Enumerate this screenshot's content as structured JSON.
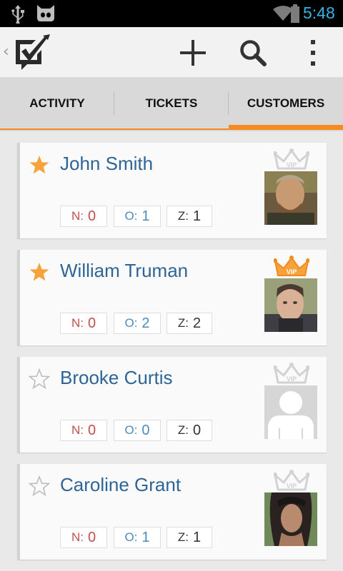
{
  "status_bar": {
    "time": "5:48"
  },
  "action_bar": {
    "up": "‹"
  },
  "tabs": [
    {
      "label": "ACTIVITY",
      "selected": false
    },
    {
      "label": "TICKETS",
      "selected": false
    },
    {
      "label": "CUSTOMERS",
      "selected": true
    }
  ],
  "customers": [
    {
      "name": "John Smith",
      "starred": true,
      "vip": false,
      "n_label": "N:",
      "n": "0",
      "o_label": "O:",
      "o": "1",
      "z_label": "Z:",
      "z": "1",
      "avatar": "photo-man-beard"
    },
    {
      "name": "William Truman",
      "starred": true,
      "vip": true,
      "n_label": "N:",
      "n": "0",
      "o_label": "O:",
      "o": "2",
      "z_label": "Z:",
      "z": "2",
      "avatar": "photo-man-shortcut"
    },
    {
      "name": "Brooke Curtis",
      "starred": false,
      "vip": false,
      "n_label": "N:",
      "n": "0",
      "o_label": "O:",
      "o": "0",
      "z_label": "Z:",
      "z": "0",
      "avatar": "placeholder-person"
    },
    {
      "name": "Caroline Grant",
      "starred": false,
      "vip": false,
      "n_label": "N:",
      "n": "0",
      "o_label": "O:",
      "o": "1",
      "z_label": "Z:",
      "z": "1",
      "avatar": "photo-woman"
    }
  ],
  "vip_badge_text": "VIP",
  "colors": {
    "accent": "#f6891f",
    "name": "#2e6496",
    "new": "#c0504d",
    "open": "#4a8bbf",
    "time": "#33b5e5",
    "star_on": "#f6a33b"
  }
}
